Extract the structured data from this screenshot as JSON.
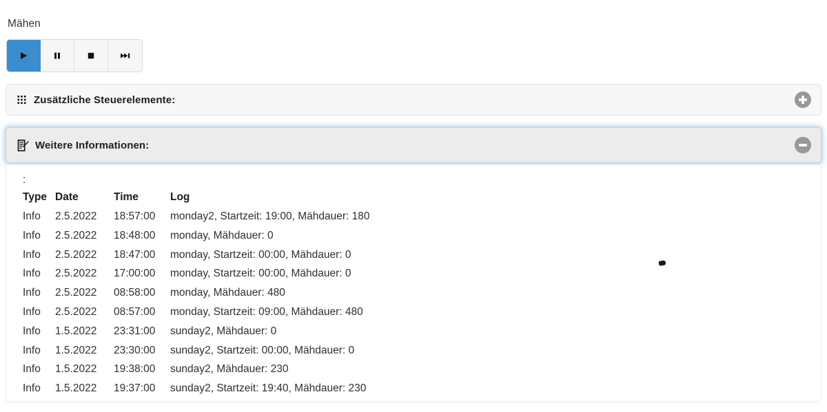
{
  "section": {
    "label": "Mähen"
  },
  "controls": {
    "buttons": [
      {
        "name": "play",
        "icon": "play-icon",
        "active": true
      },
      {
        "name": "pause",
        "icon": "pause-icon",
        "active": false
      },
      {
        "name": "stop",
        "icon": "stop-icon",
        "active": false
      },
      {
        "name": "skip-forward",
        "icon": "skip-forward-icon",
        "active": false
      }
    ],
    "active_color": "#3c8dcd",
    "inactive_color": "#f6f6f6"
  },
  "panels": [
    {
      "title": "Zusätzliche Steuerelemente:",
      "icon": "grid-dots-icon",
      "toggle_icon": "plus-circle-icon",
      "expanded": false
    },
    {
      "title": "Weitere Informationen:",
      "icon": "document-edit-icon",
      "toggle_icon": "minus-circle-icon",
      "expanded": true
    }
  ],
  "log": {
    "caption": ":",
    "columns": [
      "Type",
      "Date",
      "Time",
      "Log"
    ],
    "rows": [
      {
        "type": "Info",
        "date": "2.5.2022",
        "time": "18:57:00",
        "message": "monday2, Startzeit: 19:00, Mähdauer: 180"
      },
      {
        "type": "Info",
        "date": "2.5.2022",
        "time": "18:48:00",
        "message": "monday, Mähdauer: 0"
      },
      {
        "type": "Info",
        "date": "2.5.2022",
        "time": "18:47:00",
        "message": "monday, Startzeit: 00:00, Mähdauer: 0"
      },
      {
        "type": "Info",
        "date": "2.5.2022",
        "time": "17:00:00",
        "message": "monday, Startzeit: 00:00, Mähdauer: 0"
      },
      {
        "type": "Info",
        "date": "2.5.2022",
        "time": "08:58:00",
        "message": "monday, Mähdauer: 480"
      },
      {
        "type": "Info",
        "date": "2.5.2022",
        "time": "08:57:00",
        "message": "monday, Startzeit: 09:00, Mähdauer: 480"
      },
      {
        "type": "Info",
        "date": "1.5.2022",
        "time": "23:31:00",
        "message": "sunday2, Mähdauer: 0"
      },
      {
        "type": "Info",
        "date": "1.5.2022",
        "time": "23:30:00",
        "message": "sunday2, Startzeit: 00:00, Mähdauer: 0"
      },
      {
        "type": "Info",
        "date": "1.5.2022",
        "time": "19:38:00",
        "message": "sunday2, Mähdauer: 230"
      },
      {
        "type": "Info",
        "date": "1.5.2022",
        "time": "19:37:00",
        "message": "sunday2, Startzeit: 19:40, Mähdauer: 230"
      }
    ]
  }
}
